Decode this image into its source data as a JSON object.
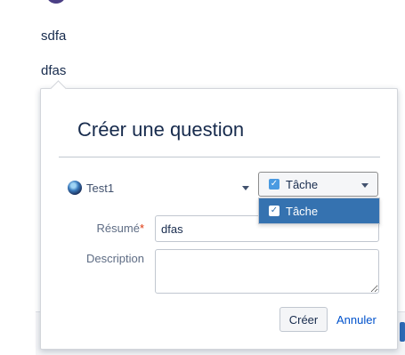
{
  "page": {
    "line1": "sdfa",
    "line2": "dfas"
  },
  "dialog": {
    "title": "Créer une question",
    "project": {
      "label": "Test1",
      "icon": "project-avatar-icon"
    },
    "issue_type": {
      "selected": "Tâche",
      "icon": "checkbox-icon",
      "options": [
        "Tâche"
      ]
    },
    "fields": {
      "summary_label": "Résumé",
      "required_marker": "*",
      "summary_value": "dfas",
      "description_label": "Description",
      "description_value": ""
    },
    "actions": {
      "create_label": "Créer",
      "cancel_label": "Annuler"
    }
  },
  "colors": {
    "accent": "#3572b0",
    "link": "#0052cc",
    "required": "#de350b"
  }
}
